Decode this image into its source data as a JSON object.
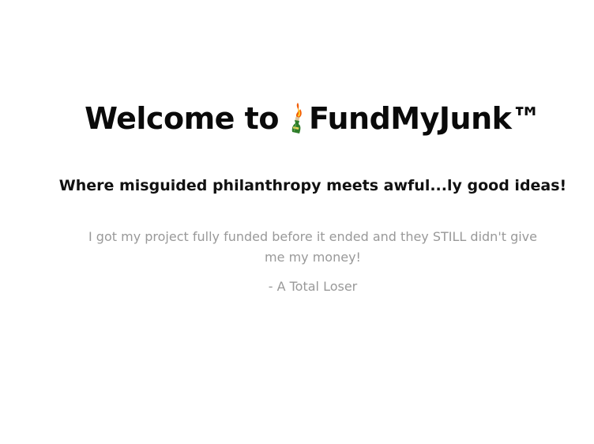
{
  "hero": {
    "title_prefix": "Welcome to",
    "brand_name": "FundMyJunk™",
    "logo_icon": "molotov-cocktail-icon",
    "tagline": "Where misguided philanthropy meets awful...ly good ideas!"
  },
  "testimonial": {
    "quote": "I got my project fully funded before it ended and they STILL didn't give me my money!",
    "attribution": "- A Total Loser"
  }
}
